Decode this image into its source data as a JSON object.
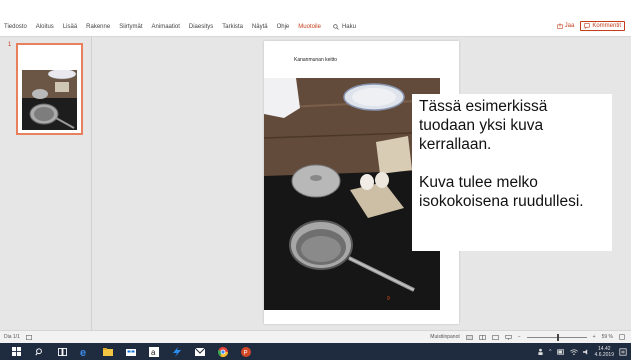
{
  "ribbon": {
    "tabs": [
      "Tiedosto",
      "Aloitus",
      "Lisää",
      "Rakenne",
      "Siirtymät",
      "Animaatiot",
      "Diaesitys",
      "Tarkista",
      "Näytä",
      "Ohje",
      "Muotoile"
    ],
    "active_tab": "Muotoile",
    "search_label": "Haku",
    "share_label": "Jaa",
    "comments_label": "Kommentit"
  },
  "thumbnails": {
    "slide_number": "1"
  },
  "slide": {
    "title": "Kananmunan keitto",
    "callout_lines": [
      "Tässä esimerkissä",
      "tuodaan yksi kuva",
      "kerrallaan.",
      "",
      "Kuva tulee melko",
      "isokokoisena ruudullesi."
    ]
  },
  "status": {
    "slide_counter": "Dia 1/1",
    "notes_label": "Muistiinpanot",
    "zoom": "59 %"
  },
  "taskbar": {
    "time": "14.42",
    "date": "4.6.2019"
  },
  "colors": {
    "accent": "#c43e1c",
    "taskbar": "#1f2b3f",
    "workspace": "#e6e6e6"
  }
}
